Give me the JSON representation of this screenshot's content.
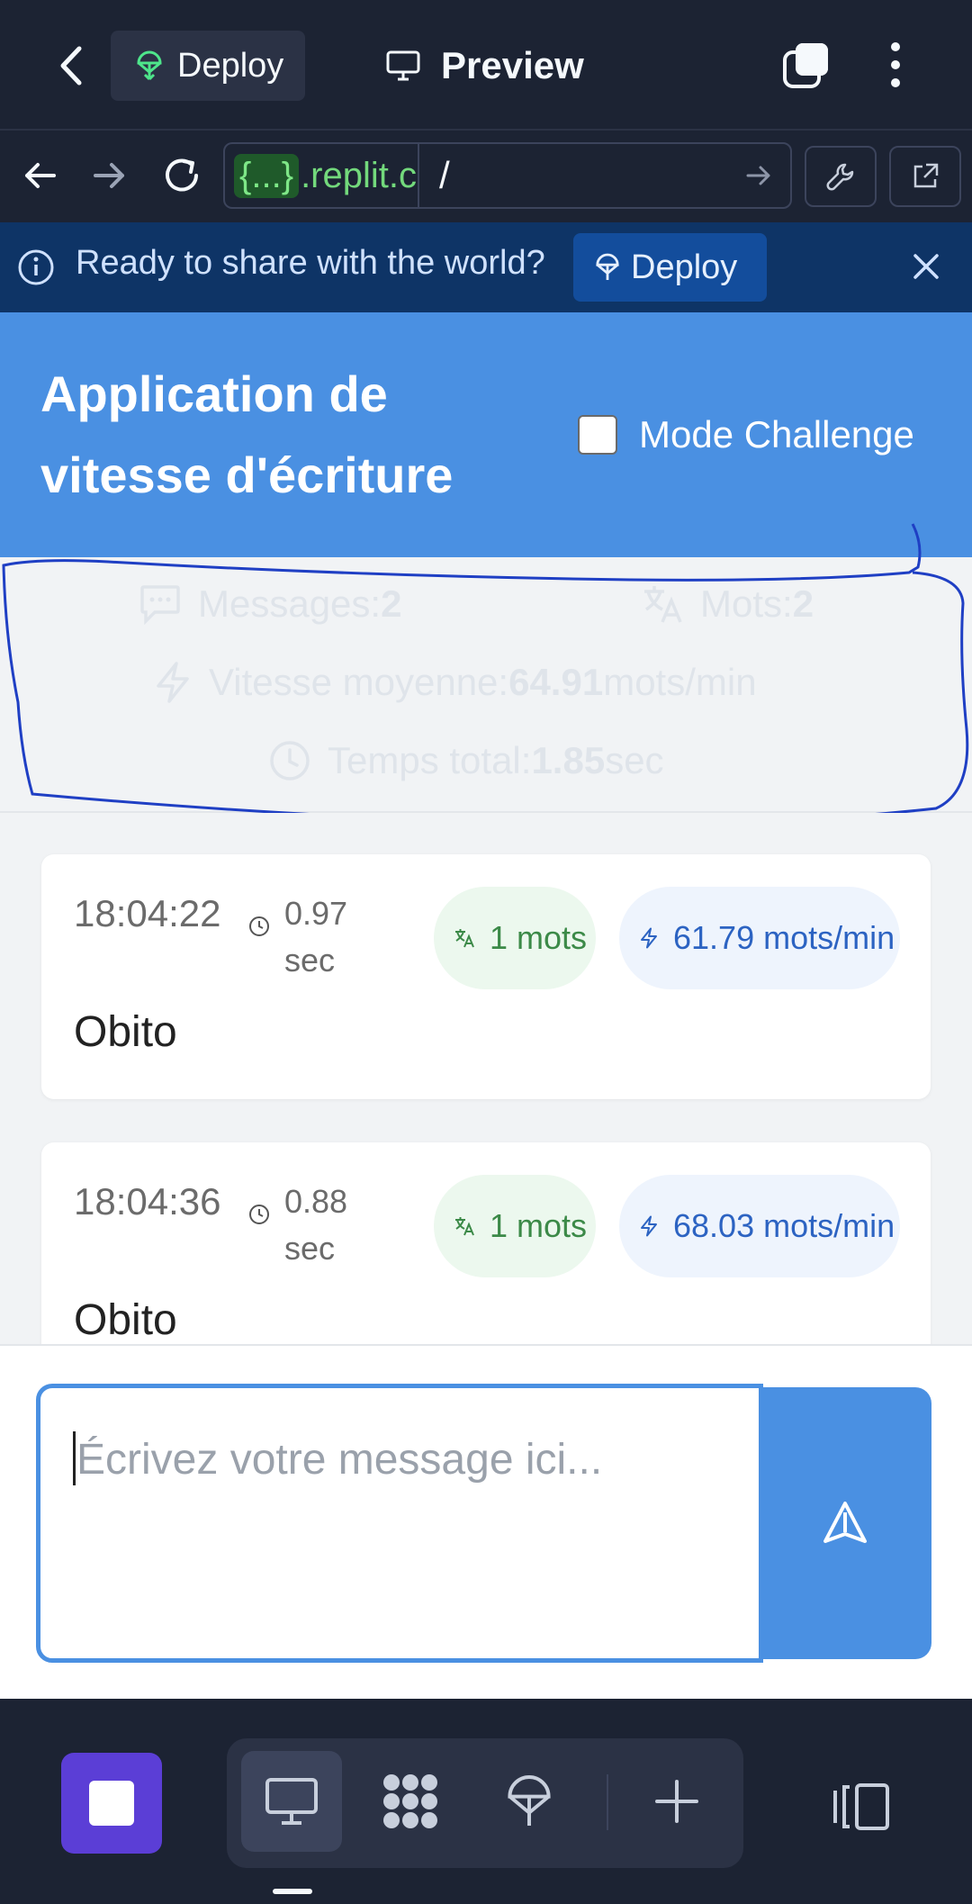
{
  "topbar": {
    "deploy_label": "Deploy",
    "preview_label": "Preview"
  },
  "urlbar": {
    "host_badge": "{...}",
    "host_suffix": ".replit.c",
    "path": "/"
  },
  "banner": {
    "text": "Ready to share with the world?",
    "deploy_label": "Deploy"
  },
  "app": {
    "title": "Application de vitesse d'écriture",
    "challenge_label": "Mode Challenge",
    "challenge_checked": false
  },
  "stats": {
    "messages_label": "Messages: ",
    "messages_value": "2",
    "words_label": "Mots: ",
    "words_value": "2",
    "speed_label": "Vitesse moyenne: ",
    "speed_value": "64.91",
    "speed_unit": "mots/min",
    "time_label": "Temps total: ",
    "time_value": "1.85",
    "time_unit": "sec"
  },
  "messages": [
    {
      "time": "18:04:22",
      "duration": "0.97 sec",
      "words": "1 mots",
      "speed": "61.79 mots/min",
      "text": "Obito"
    },
    {
      "time": "18:04:36",
      "duration": "0.88 sec",
      "words": "1 mots",
      "speed": "68.03 mots/min",
      "text": "Obito"
    }
  ],
  "composer": {
    "placeholder": "Écrivez votre message ici..."
  },
  "colors": {
    "app_header": "#4a90e2",
    "replit_bg": "#1c2333",
    "banner_bg": "#0e3466",
    "stop_button": "#5b3ed6"
  }
}
